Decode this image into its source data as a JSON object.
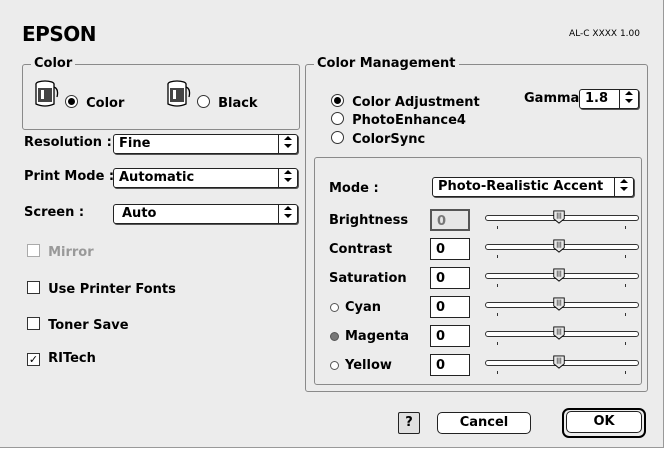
{
  "brand": "EPSON",
  "model": "AL-C XXXX 1.00",
  "color_group": {
    "title": "Color",
    "options": [
      {
        "label": "Color",
        "selected": true
      },
      {
        "label": "Black",
        "selected": false
      }
    ]
  },
  "settings": {
    "resolution": {
      "label": "Resolution :",
      "value": "Fine"
    },
    "print_mode": {
      "label": "Print Mode :",
      "value": "Automatic"
    },
    "screen": {
      "label": "Screen :",
      "value": "Auto"
    }
  },
  "checkboxes": {
    "mirror": {
      "label": "Mirror",
      "checked": false,
      "enabled": false
    },
    "printer_fonts": {
      "label": "Use Printer Fonts",
      "checked": false
    },
    "toner_save": {
      "label": "Toner Save",
      "checked": false
    },
    "ritech": {
      "label": "RITech",
      "checked": true
    }
  },
  "color_management": {
    "title": "Color Management",
    "options": [
      {
        "label": "Color Adjustment",
        "selected": true
      },
      {
        "label": "PhotoEnhance4",
        "selected": false
      },
      {
        "label": "ColorSync",
        "selected": false
      }
    ],
    "gamma": {
      "label": "Gamma",
      "value": "1.8"
    },
    "mode": {
      "label": "Mode :",
      "value": "Photo-Realistic Accent"
    },
    "adjustments": [
      {
        "label": "Brightness",
        "value": "0",
        "dot": "none"
      },
      {
        "label": "Contrast",
        "value": "0",
        "dot": "none"
      },
      {
        "label": "Saturation",
        "value": "0",
        "dot": "none"
      },
      {
        "label": "Cyan",
        "value": "0",
        "dot": "empty"
      },
      {
        "label": "Magenta",
        "value": "0",
        "dot": "filled"
      },
      {
        "label": "Yellow",
        "value": "0",
        "dot": "empty"
      }
    ]
  },
  "buttons": {
    "help": "?",
    "cancel": "Cancel",
    "ok": "OK"
  },
  "colors": {
    "dialog_bg": "#ececec",
    "border": "#8a8a8a"
  }
}
